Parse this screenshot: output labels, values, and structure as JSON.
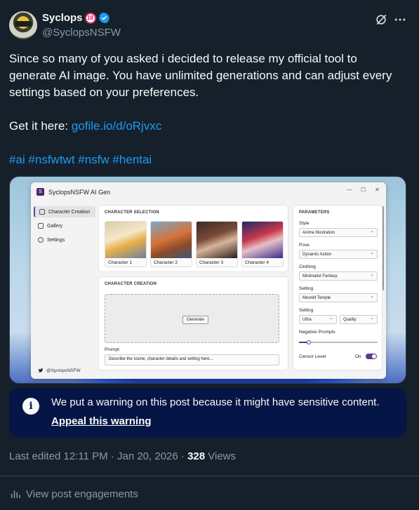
{
  "author": {
    "display_name": "Syclops",
    "age_badge": "18",
    "handle": "@SyclopsNSFW"
  },
  "tweet": {
    "line1": "Since so many of you asked i decided to release my official tool to",
    "line2": "generate AI image. You have unlimited generations and can adjust every",
    "line3": "settings based on your preferences.",
    "get_it": "Get it here: ",
    "link": "gofile.io/d/oRjvxc",
    "hashtags": "#ai #nsfwtwt #nsfw #hentai"
  },
  "app": {
    "title": "SyclopsNSFW AI Gen",
    "logo_letter": "S",
    "win_min": "—",
    "win_max": "☐",
    "win_close": "✕",
    "nav": [
      "Character Creation",
      "Gallery",
      "Settings"
    ],
    "footer_handle": "@SyclopsNSFW",
    "character_selection_title": "CHARACTER SELECTION",
    "characters": [
      "Character 1",
      "Character 2",
      "Character 3",
      "Character 4"
    ],
    "character_creation_title": "CHARACTER CREATION",
    "generate_button": "Generate",
    "prompt_label": "Prompt",
    "prompt_placeholder": "Describe the scene, character details and setting here...",
    "parameters_title": "PARAMETERS",
    "style_label": "Style",
    "style_value": "Anime Illustration",
    "pose_label": "Pose",
    "pose_value": "Dynamic Action",
    "clothing_label": "Clothing",
    "clothing_value": "Minimalist Fantasy",
    "setting_label": "Setting",
    "setting_value": "Moonlit Temple",
    "setting2_label": "Setting",
    "quality_level": "Ultra",
    "quality_label": "Quality",
    "negative_prompts_label": "Negative Prompts",
    "censor_label": "Censor Level",
    "censor_state": "On"
  },
  "warning": {
    "text": "We put a warning on this post because it might have sensitive content.",
    "appeal": "Appeal this warning"
  },
  "meta": {
    "edited": "Last edited 12:11 PM · Jan 20, 2026 · ",
    "views_count": "328",
    "views_label": " Views"
  },
  "engagements": "View post engagements",
  "colors": {
    "background": "#15202b",
    "link": "#1d9bf0",
    "warning_bg": "#051545",
    "muted": "#8b98a5",
    "accent_purple": "#5a3a8a"
  }
}
